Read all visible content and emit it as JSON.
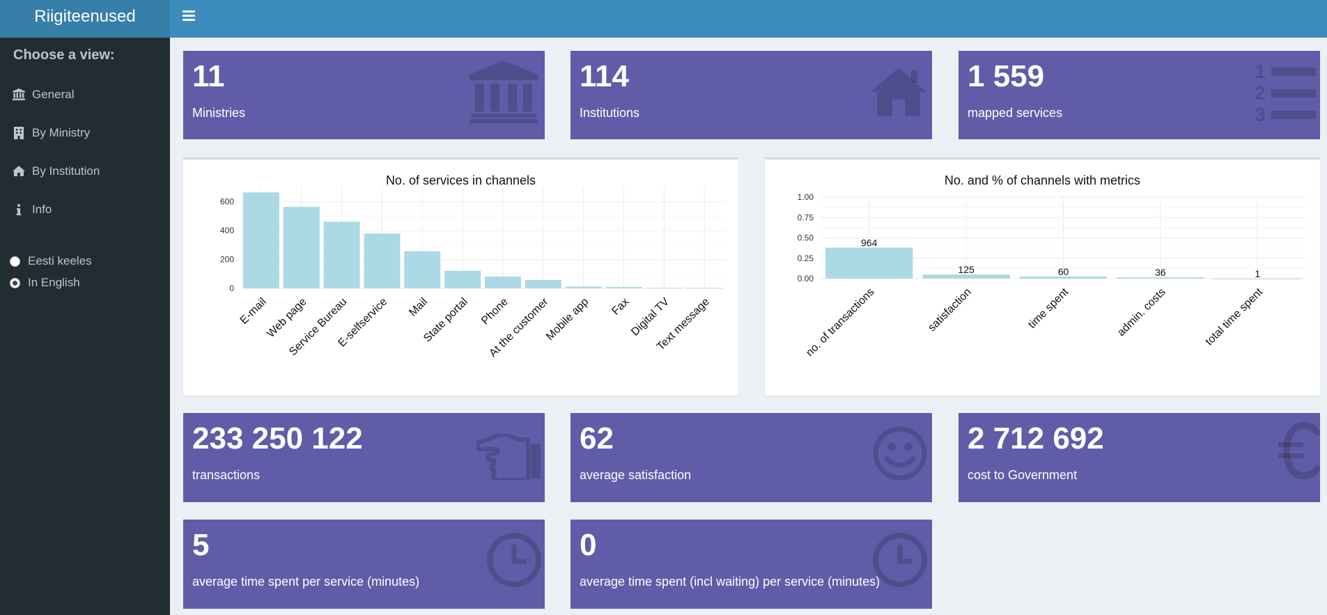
{
  "app": {
    "title": "Riigiteenused"
  },
  "sidebar": {
    "header": "Choose a view:",
    "items": [
      {
        "label": "General",
        "icon": "bank-icon"
      },
      {
        "label": "By Ministry",
        "icon": "building-icon"
      },
      {
        "label": "By Institution",
        "icon": "home-icon"
      },
      {
        "label": "Info",
        "icon": "info-icon"
      }
    ],
    "languages": [
      {
        "label": "Eesti keeles",
        "selected": false
      },
      {
        "label": "In English",
        "selected": true
      }
    ]
  },
  "stats_top": [
    {
      "value": "11",
      "label": "Ministries",
      "icon": "bank-icon"
    },
    {
      "value": "114",
      "label": "Institutions",
      "icon": "home-icon"
    },
    {
      "value": "1 559",
      "label": "mapped services",
      "icon": "ordered-list-icon"
    }
  ],
  "stats_bottom": [
    {
      "value": "233 250 122",
      "label": "transactions",
      "icon": "hand-pointer-icon"
    },
    {
      "value": "62",
      "label": "average satisfaction",
      "icon": "smile-icon"
    },
    {
      "value": "2 712 692",
      "label": "cost to Government",
      "icon": "euro-icon"
    },
    {
      "value": "5",
      "label": "average time spent per service (minutes)",
      "icon": "clock-icon"
    },
    {
      "value": "0",
      "label": "average time spent (incl waiting) per service (minutes)",
      "icon": "clock-icon"
    }
  ],
  "colors": {
    "box": "#605ca8",
    "bar": "#add8e6",
    "header": "#3c8dbc",
    "logo": "#367fa9",
    "sidebar": "#222d32"
  },
  "chart_data": [
    {
      "type": "bar",
      "title": "No. of services in channels",
      "categories": [
        "E-mail",
        "Web page",
        "Service Bureau",
        "E-selfservice",
        "Mail",
        "State portal",
        "Phone",
        "At the customer",
        "Mobile app",
        "Fax",
        "Digital TV",
        "Text message"
      ],
      "values": [
        665,
        565,
        462,
        380,
        258,
        122,
        82,
        58,
        12,
        9,
        4,
        3
      ],
      "yticks": [
        "0",
        "200",
        "400",
        "600"
      ],
      "ylim": [
        0,
        700
      ],
      "grid": true
    },
    {
      "type": "bar",
      "title": "No. and % of channels with metrics",
      "categories": [
        "no. of transactions",
        "satisfaction",
        "time spent",
        "admin. costs",
        "total time spent"
      ],
      "values": [
        0.38,
        0.05,
        0.025,
        0.015,
        0.0005
      ],
      "data_labels": [
        "964",
        "125",
        "60",
        "36",
        "1"
      ],
      "yticks": [
        "0.00",
        "0.25",
        "0.50",
        "0.75",
        "1.00"
      ],
      "ylim": [
        0,
        1
      ],
      "grid": true
    }
  ]
}
